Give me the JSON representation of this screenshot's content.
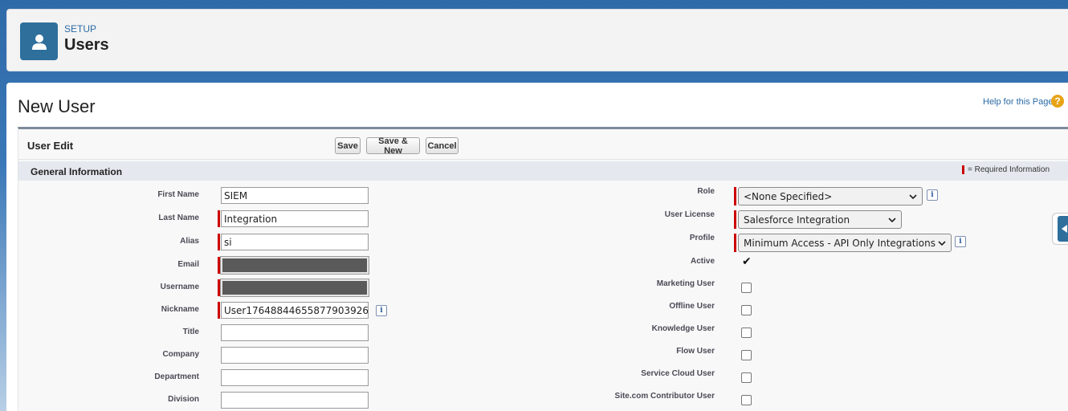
{
  "header": {
    "eyebrow": "SETUP",
    "title": "Users",
    "icon": "user-icon"
  },
  "page": {
    "title": "New User",
    "help_link": "Help for this Page",
    "help_icon": "?"
  },
  "block": {
    "title": "User Edit",
    "buttons": {
      "save": "Save",
      "save_new": "Save & New",
      "cancel": "Cancel"
    }
  },
  "section": {
    "title": "General Information",
    "required_legend": "= Required Information"
  },
  "left_fields": {
    "first_name": {
      "label": "First Name",
      "value": "SIEM"
    },
    "last_name": {
      "label": "Last Name",
      "value": "Integration"
    },
    "alias": {
      "label": "Alias",
      "value": "si"
    },
    "email": {
      "label": "Email",
      "value": ""
    },
    "username": {
      "label": "Username",
      "value": ""
    },
    "nickname": {
      "label": "Nickname",
      "value": "User17648844655877903926"
    },
    "title": {
      "label": "Title",
      "value": ""
    },
    "company": {
      "label": "Company",
      "value": ""
    },
    "department": {
      "label": "Department",
      "value": ""
    },
    "division": {
      "label": "Division",
      "value": ""
    }
  },
  "right_fields": {
    "role": {
      "label": "Role",
      "value": "<None Specified>"
    },
    "user_license": {
      "label": "User License",
      "value": "Salesforce Integration"
    },
    "profile": {
      "label": "Profile",
      "value": "Minimum Access - API Only Integrations"
    },
    "active": {
      "label": "Active",
      "checked": true
    },
    "marketing_user": {
      "label": "Marketing User",
      "checked": false
    },
    "offline_user": {
      "label": "Offline User",
      "checked": false
    },
    "knowledge_user": {
      "label": "Knowledge User",
      "checked": false
    },
    "flow_user": {
      "label": "Flow User",
      "checked": false
    },
    "service_cloud_user": {
      "label": "Service Cloud User",
      "checked": false
    },
    "site_contributor_user": {
      "label": "Site.com Contributor User",
      "checked": false
    }
  },
  "colors": {
    "required": "#c00000",
    "brand": "#2e6f9c",
    "link": "#2a6aa5"
  }
}
